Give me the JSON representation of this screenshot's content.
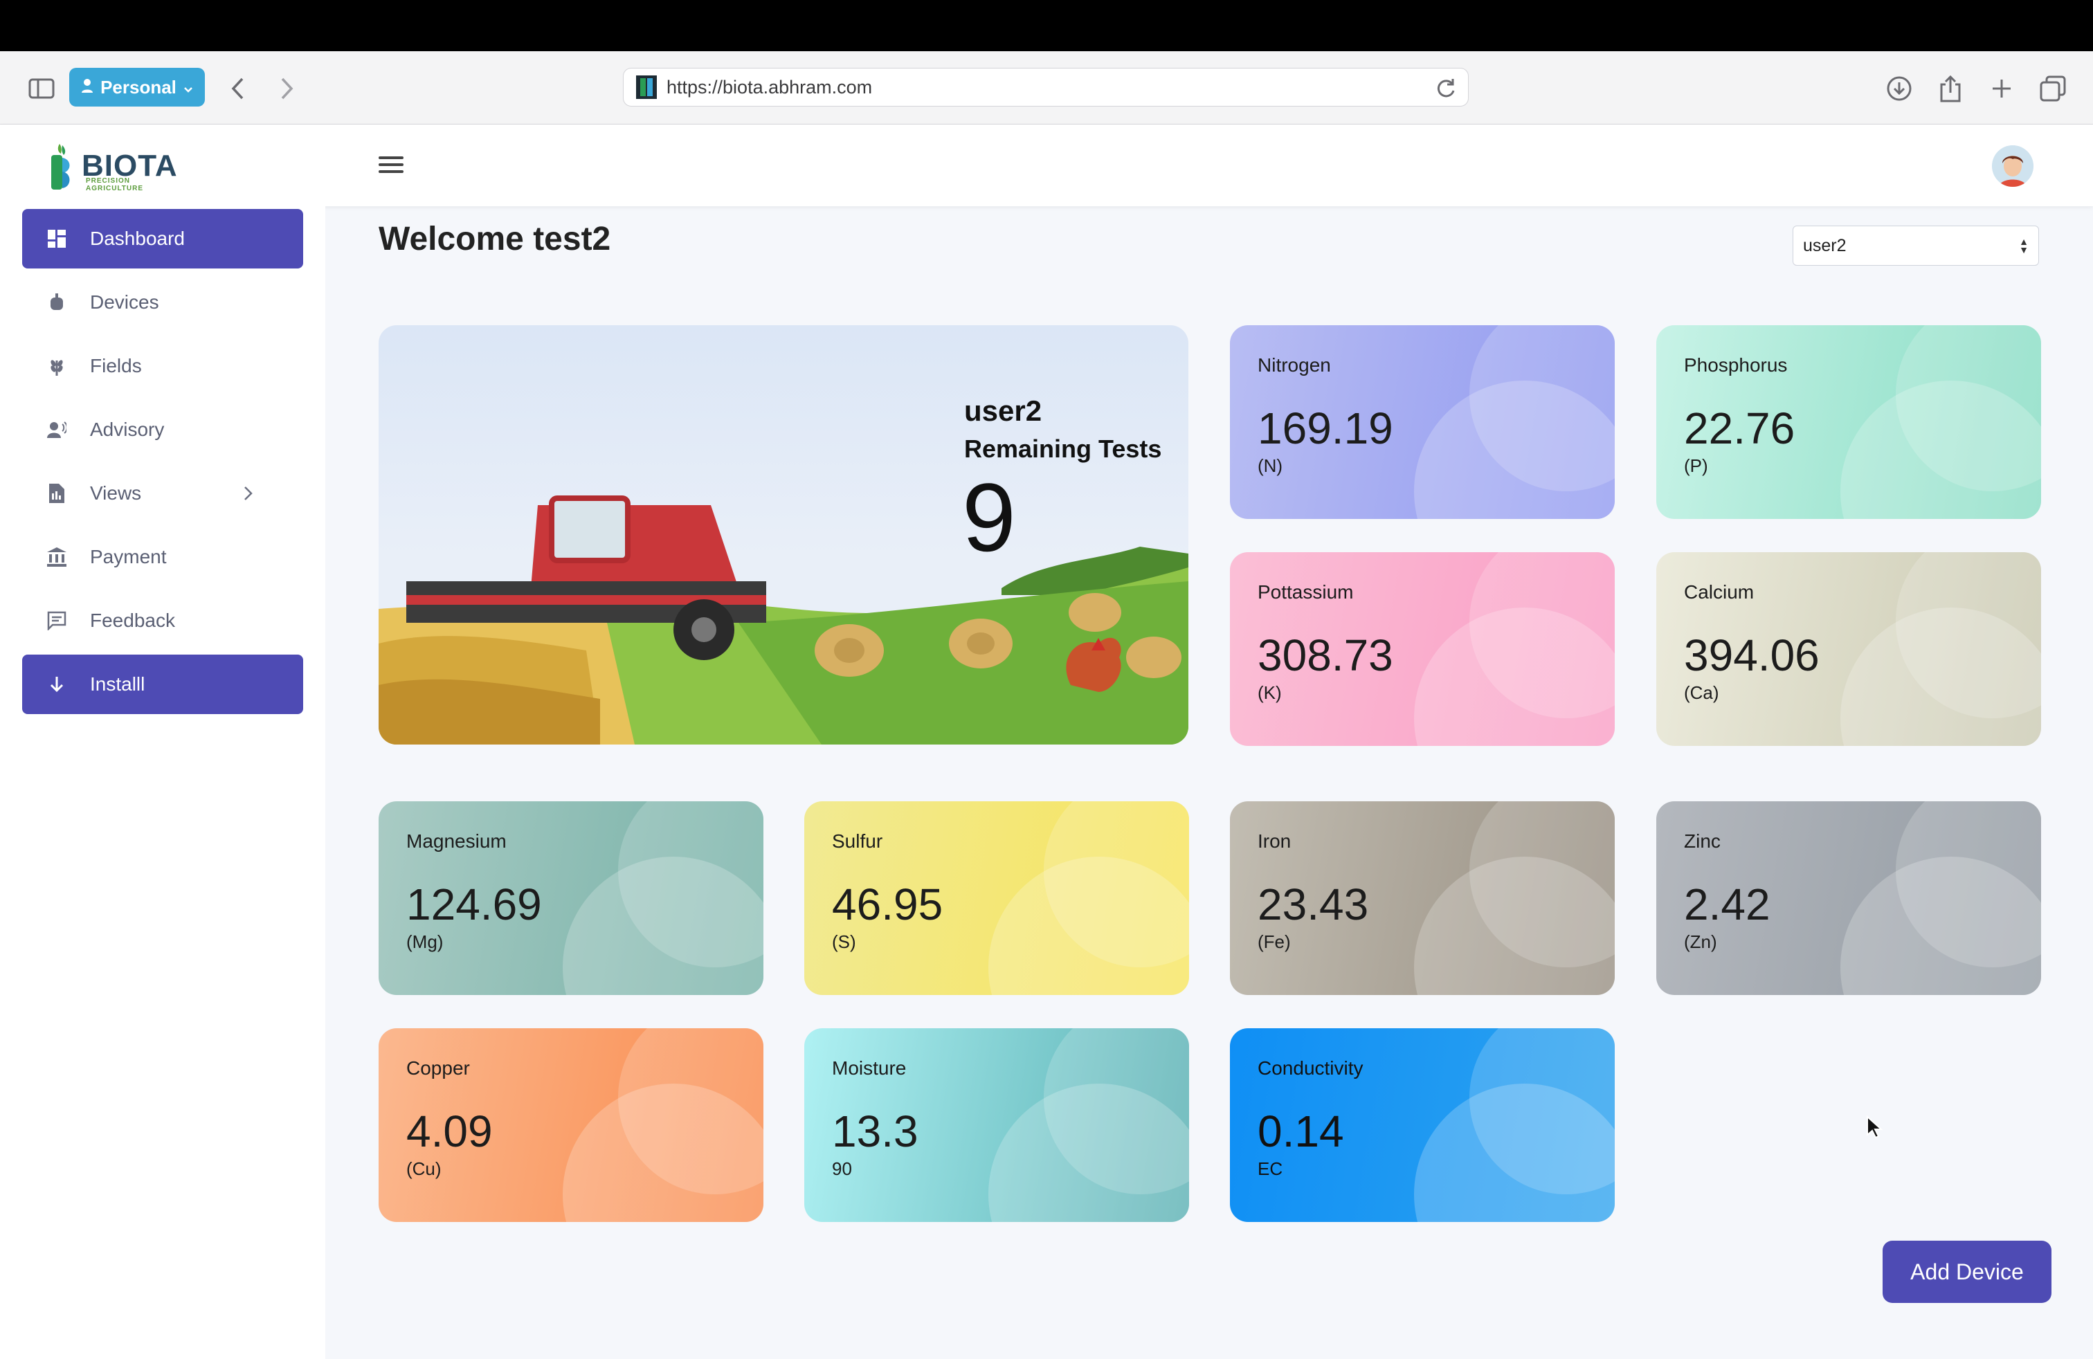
{
  "browser": {
    "profile_label": "Personal",
    "url": "https://biota.abhram.com"
  },
  "app": {
    "logo_text": "BIOTA",
    "logo_sub": "PRECISION AGRICULTURE"
  },
  "sidebar": {
    "items": [
      {
        "label": "Dashboard",
        "icon": "dashboard-icon"
      },
      {
        "label": "Devices",
        "icon": "device-icon"
      },
      {
        "label": "Fields",
        "icon": "wheat-icon"
      },
      {
        "label": "Advisory",
        "icon": "advisory-icon"
      },
      {
        "label": "Views",
        "icon": "views-icon"
      },
      {
        "label": "Payment",
        "icon": "bank-icon"
      },
      {
        "label": "Feedback",
        "icon": "feedback-icon"
      },
      {
        "label": "Installl",
        "icon": "arrow-down-icon"
      }
    ]
  },
  "main": {
    "welcome": "Welcome test2",
    "user_select": "user2",
    "hero": {
      "user": "user2",
      "remaining_label": "Remaining Tests",
      "remaining_count": "9"
    },
    "cards": [
      {
        "label": "Nitrogen",
        "value": "169.19",
        "unit": "(N)",
        "color1": "#b8bdf3",
        "color2": "#8f98f0"
      },
      {
        "label": "Phosphorus",
        "value": "22.76",
        "unit": "(P)",
        "color1": "#c8f3e7",
        "color2": "#86dcc3"
      },
      {
        "label": "Pottassium",
        "value": "308.73",
        "unit": "(K)",
        "color1": "#fbbfd6",
        "color2": "#f99cc4"
      },
      {
        "label": "Calcium",
        "value": "394.06",
        "unit": "(Ca)",
        "color1": "#ecebdc",
        "color2": "#c9c8b0"
      },
      {
        "label": "Magnesium",
        "value": "124.69",
        "unit": "(Mg)",
        "color1": "#a9cbc4",
        "color2": "#74b0a6"
      },
      {
        "label": "Sulfur",
        "value": "46.95",
        "unit": "(S)",
        "color1": "#f1ea93",
        "color2": "#f7e45a"
      },
      {
        "label": "Iron",
        "value": "23.43",
        "unit": "(Fe)",
        "color1": "#c2bdb2",
        "color2": "#968d80"
      },
      {
        "label": "Zinc",
        "value": "2.42",
        "unit": "(Zn)",
        "color1": "#b4b8be",
        "color2": "#929aa2"
      },
      {
        "label": "Copper",
        "value": "4.09",
        "unit": "(Cu)",
        "color1": "#fbb88f",
        "color2": "#f9894a"
      },
      {
        "label": "Moisture",
        "value": "13.3",
        "unit": "90",
        "color1": "#aff1f3",
        "color2": "#56aeb1"
      },
      {
        "label": "Conductivity",
        "value": "0.14",
        "unit": "EC",
        "color1": "#0f8ff5",
        "color2": "#2ea3ef"
      }
    ],
    "add_device_label": "Add Device"
  }
}
